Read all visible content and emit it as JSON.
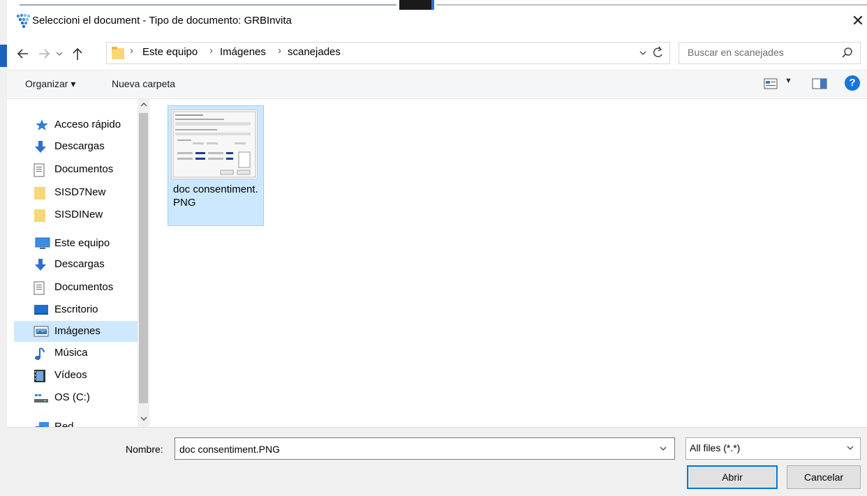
{
  "window": {
    "title": "Seleccioni el document - Tipo de documento: GRBInvita",
    "close": "✕"
  },
  "address": {
    "breadcrumb": [
      "Este equipo",
      "Imágenes",
      "scanejades"
    ],
    "search_placeholder": "Buscar en scanejades"
  },
  "toolbar": {
    "organize": "Organizar ▾",
    "new_folder": "Nueva carpeta",
    "help": "?"
  },
  "navigation": {
    "quick_access": "Acceso rápido",
    "quick_items": [
      "Descargas",
      "Documentos",
      "SISD7New",
      "SISDINew"
    ],
    "this_pc": "Este equipo",
    "pc_items": [
      "Descargas",
      "Documentos",
      "Escritorio",
      "Imágenes",
      "Música",
      "Vídeos",
      "OS (C:)"
    ],
    "network": "Red",
    "selected": "Imágenes"
  },
  "files": [
    {
      "name": "doc consentiment.PNG",
      "selected": true
    }
  ],
  "footer": {
    "name_label": "Nombre:",
    "name_value": "doc consentiment.PNG",
    "filter_value": "All files (*.*)",
    "open_button": "Abrir",
    "cancel_button": "Cancelar"
  },
  "colors": {
    "selection_bg": "#cce8ff",
    "accent": "#0078d7",
    "help_blue": "#1577d8"
  }
}
